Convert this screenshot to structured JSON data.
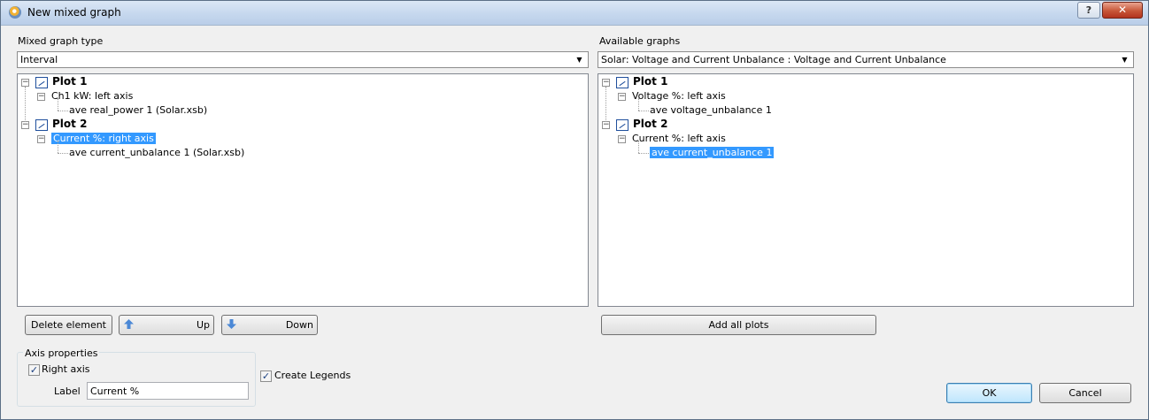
{
  "window": {
    "title": "New mixed graph",
    "help_label": "?",
    "close_label": "✕"
  },
  "left": {
    "type_label": "Mixed graph type",
    "type_value": "Interval",
    "tree": [
      {
        "label": "Plot 1",
        "bold": true,
        "level": 0,
        "selected": false
      },
      {
        "label": "Ch1 kW: left axis",
        "bold": false,
        "level": 1,
        "selected": false
      },
      {
        "label": "ave real_power 1  (Solar.xsb)",
        "bold": false,
        "level": 2,
        "selected": false
      },
      {
        "label": "Plot 2",
        "bold": true,
        "level": 0,
        "selected": false
      },
      {
        "label": "Current %: right axis",
        "bold": false,
        "level": 1,
        "selected": true
      },
      {
        "label": "ave current_unbalance 1  (Solar.xsb)",
        "bold": false,
        "level": 2,
        "selected": false
      }
    ],
    "delete_label": "Delete element",
    "up_label": "Up",
    "down_label": "Down"
  },
  "right": {
    "available_label": "Available graphs",
    "available_value": "Solar: Voltage and Current Unbalance : Voltage and Current Unbalance",
    "tree": [
      {
        "label": "Plot 1",
        "bold": true,
        "level": 0,
        "selected": false
      },
      {
        "label": "Voltage %: left axis",
        "bold": false,
        "level": 1,
        "selected": false
      },
      {
        "label": "ave voltage_unbalance 1",
        "bold": false,
        "level": 2,
        "selected": false
      },
      {
        "label": "Plot 2",
        "bold": true,
        "level": 0,
        "selected": false
      },
      {
        "label": "Current %: left axis",
        "bold": false,
        "level": 1,
        "selected": false
      },
      {
        "label": "ave current_unbalance 1",
        "bold": false,
        "level": 2,
        "selected": true
      }
    ],
    "add_all_label": "Add all plots"
  },
  "axis": {
    "group_label": "Axis properties",
    "right_axis_label": "Right axis",
    "right_axis_checked": true,
    "label_caption": "Label",
    "label_value": "Current %"
  },
  "legends": {
    "label": "Create Legends",
    "checked": true
  },
  "footer": {
    "ok_label": "OK",
    "cancel_label": "Cancel"
  },
  "icons": {
    "app": "app-eye-icon",
    "plot": "plot-graph-icon",
    "up": "arrow-up-icon",
    "down": "arrow-down-icon",
    "check": "✓",
    "combo_arrow": "▼",
    "collapse": "−"
  },
  "colors": {
    "selection": "#3399ff",
    "titlebar": "#c6d8ee",
    "close": "#c75638"
  }
}
